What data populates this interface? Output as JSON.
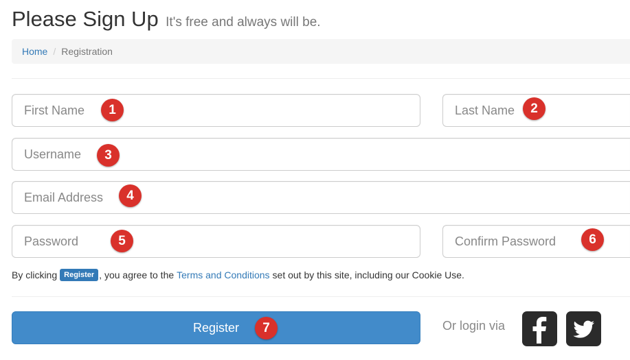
{
  "header": {
    "title": "Please Sign Up",
    "subtitle": "It's free and always will be."
  },
  "breadcrumb": {
    "home": "Home",
    "separator": "/",
    "current": "Registration"
  },
  "form": {
    "first_name_placeholder": "First Name",
    "last_name_placeholder": "Last Name",
    "username_placeholder": "Username",
    "email_placeholder": "Email Address",
    "password_placeholder": "Password",
    "confirm_password_placeholder": "Confirm Password"
  },
  "markers": [
    "1",
    "2",
    "3",
    "4",
    "5",
    "6",
    "7"
  ],
  "terms": {
    "prefix": "By clicking",
    "badge": "Register",
    "middle": ", you agree to the",
    "link": "Terms and Conditions",
    "suffix": "set out by this site, including our Cookie Use."
  },
  "actions": {
    "register_label": "Register",
    "or_login_via": "Or login via"
  },
  "social": {
    "facebook_icon": "facebook-icon",
    "twitter_icon": "twitter-icon"
  },
  "colors": {
    "primary": "#428bca",
    "link": "#337ab7",
    "marker": "#d9312b",
    "social_bg": "#2b2b2b"
  }
}
